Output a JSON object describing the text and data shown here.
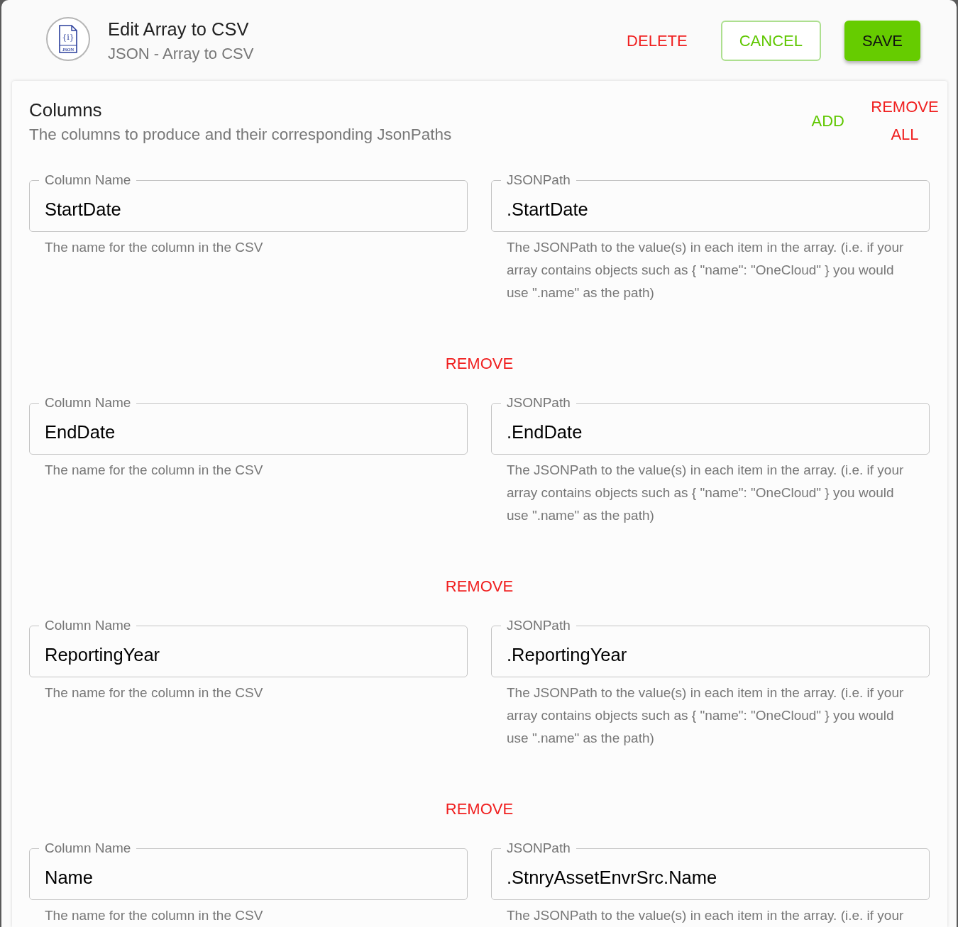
{
  "header": {
    "title": "Edit Array to CSV",
    "subtitle": "JSON - Array to CSV",
    "icon_symbol": "{i}",
    "icon_label": "JSON"
  },
  "actions": [
    {
      "label": "DELETE",
      "kind": "delete"
    },
    {
      "label": "CANCEL",
      "kind": "cancel"
    },
    {
      "label": "SAVE",
      "kind": "save"
    }
  ],
  "section": {
    "title": "Columns",
    "description": "The columns to produce and their corresponding JsonPaths",
    "actions": [
      {
        "label": "ADD",
        "kind": "add"
      },
      {
        "label": "REMOVE ALL",
        "kind": "remove_all"
      }
    ]
  },
  "columns": [
    {
      "name_field": {
        "label": "Column Name",
        "value": "StartDate",
        "helper": "The name for the column in the CSV"
      },
      "path_field": {
        "label": "JSONPath",
        "value": ".StartDate",
        "helper": "The JSONPath to the value(s) in each item in the array. (i.e. if your array contains objects such as { \"name\": \"OneCloud\" } you would use \".name\" as the path)"
      },
      "remove_button": "REMOVE"
    },
    {
      "name_field": {
        "label": "Column Name",
        "value": "EndDate",
        "helper": "The name for the column in the CSV"
      },
      "path_field": {
        "label": "JSONPath",
        "value": ".EndDate",
        "helper": "The JSONPath to the value(s) in each item in the array. (i.e. if your array contains objects such as { \"name\": \"OneCloud\" } you would use \".name\" as the path)"
      },
      "remove_button": "REMOVE"
    },
    {
      "name_field": {
        "label": "Column Name",
        "value": "ReportingYear",
        "helper": "The name for the column in the CSV"
      },
      "path_field": {
        "label": "JSONPath",
        "value": ".ReportingYear",
        "helper": "The JSONPath to the value(s) in each item in the array. (i.e. if your array contains objects such as { \"name\": \"OneCloud\" } you would use \".name\" as the path)"
      },
      "remove_button": "REMOVE"
    },
    {
      "name_field": {
        "label": "Column Name",
        "value": "Name",
        "helper": "The name for the column in the CSV"
      },
      "path_field": {
        "label": "JSONPath",
        "value": ".StnryAssetEnvrSrc.Name",
        "helper": "The JSONPath to the value(s) in each item in the array. (i.e. if your"
      }
    }
  ]
}
